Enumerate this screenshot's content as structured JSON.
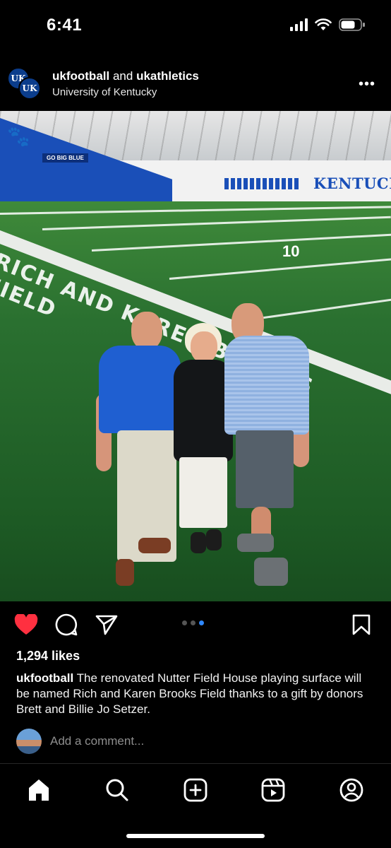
{
  "status_bar": {
    "time": "6:41"
  },
  "post": {
    "account_primary": "ukfootball",
    "joiner": "and",
    "account_secondary": "ukathletics",
    "location": "University of Kentucky",
    "avatar_initials": "UK",
    "photo_signage": {
      "wall_banner": "GO BIG BLUE",
      "wall_lettering": "KENTUCKY",
      "field_lettering": "RICH AND KAREN BROOKS FIELD",
      "yard_number": "10"
    },
    "carousel": {
      "total": 3,
      "active_index": 3
    },
    "likes": "1,294 likes",
    "caption_user": "ukfootball",
    "caption_text": "The renovated Nutter Field House playing surface will be named Rich and Karen Brooks Field thanks to a gift by donors Brett and Billie Jo Setzer.",
    "comment_placeholder": "Add a comment..."
  },
  "icons": {
    "like": "heart-icon",
    "comment": "comment-icon",
    "share": "send-icon",
    "save": "bookmark-icon",
    "tabs": [
      "home-icon",
      "search-icon",
      "create-icon",
      "reels-icon",
      "profile-icon"
    ]
  },
  "colors": {
    "like_red": "#ff3040",
    "carousel_active": "#2f88ff",
    "uk_blue": "#1a4fb8"
  }
}
